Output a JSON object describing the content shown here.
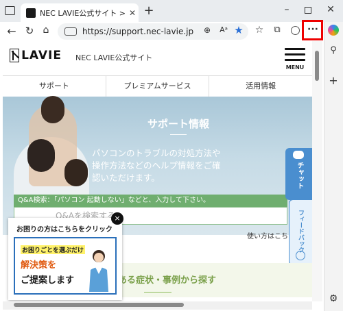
{
  "browser": {
    "tab_title": "NEC LAVIE公式サイト > サービス&サ",
    "url": "https://support.nec-lavie.jp",
    "more_button_label": "···"
  },
  "site": {
    "logo_text": "LAVIE",
    "site_name": "NEC LAVIE公式サイト",
    "menu_label": "MENU"
  },
  "nav": {
    "items": [
      {
        "label": "サポート"
      },
      {
        "label": "プレミアムサービス"
      },
      {
        "label": "活用情報"
      }
    ]
  },
  "hero": {
    "title": "サポート情報",
    "line1": "パソコンのトラブルの対処方法や",
    "line2": "操作方法などのヘルプ情報をご確",
    "line3": "認いただけます。"
  },
  "search": {
    "hint": "Q&A検索：「パソコン 起動しない」などと、入力して下さい。",
    "placeholder": "Q&Aを検索する",
    "howto": "使い方はこち"
  },
  "side_tabs": {
    "chat": "チャット",
    "feedback": "フィードバック"
  },
  "symptom": {
    "title": "ある症状・事例から探す"
  },
  "popup": {
    "header": "お困りの方はこちらをクリック",
    "close": "×",
    "banner_line1": "お困りごとを選ぶだけ",
    "banner_line2": "解決策を",
    "banner_line3": "ご提案します"
  },
  "colors": {
    "accent_green": "#6fae6f",
    "chat_blue": "#4a8ecf",
    "highlight_red": "#e00000"
  }
}
